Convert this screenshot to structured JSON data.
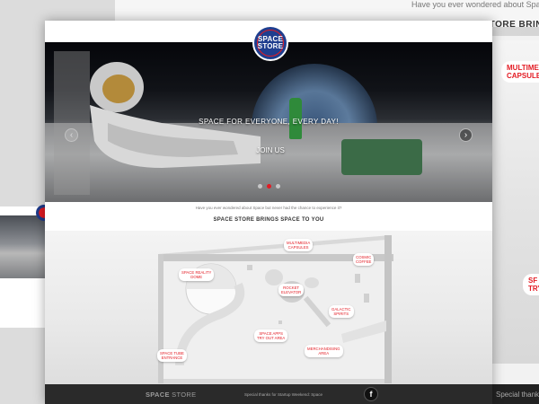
{
  "background": {
    "top_page_text": "Have you ever wondered about Space b",
    "top_page_heading": "SPACE STORE BRIN",
    "right_labels": [
      {
        "text": "MULTIMED\nCAPSULES"
      },
      {
        "text": "SF\nTRY"
      }
    ],
    "right_footer_text": "Special thanks"
  },
  "logo": {
    "line1": "SPACE",
    "line2": "STORE"
  },
  "hero": {
    "tagline": "SPACE FOR EVERYONE, EVERY DAY!",
    "cta": "JOIN US",
    "prev_icon": "chevron-left-icon",
    "next_icon": "chevron-right-icon",
    "slides": 3,
    "active_slide": 2
  },
  "intro_text": "Have you ever wondered about Space but never had the chance to experience it?",
  "section_title": "SPACE STORE BRINGS SPACE TO YOU",
  "map_labels": {
    "multimedia": "MULTIMEDIA\nCAPSULES",
    "cosmic_coffee": "COSMIC\nCOFFEE",
    "space_reality_dome": "SPACE REALITY\nDOME",
    "rocket_elevator": "ROCKET\nELEVATOR",
    "galactic_spirits": "GALACTIC\nSPIRITS",
    "space_tube": "SPACE TUBE\nENTRANCE",
    "space_apps": "SPACE APPS\nTRY OUT AREA",
    "merchandising": "MERCHANDISING\nAREA"
  },
  "footer": {
    "brand_bold": "SPACE",
    "brand_light": " STORE",
    "thanks": "Special thanks for Startup Weekend: Space",
    "facebook_icon": "f"
  },
  "colors": {
    "accent": "#e31b23",
    "brand_blue": "#1f3e8f",
    "footer_bg": "#2a2a2a"
  }
}
